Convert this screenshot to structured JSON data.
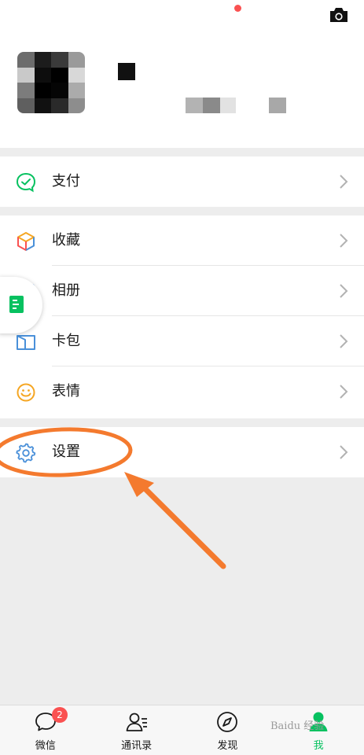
{
  "menu": {
    "pay": {
      "label": "支付",
      "icon": "pay-icon"
    },
    "favorites": {
      "label": "收藏",
      "icon": "favorites-cube-icon"
    },
    "album": {
      "label": "相册",
      "icon": "album-icon"
    },
    "cards": {
      "label": "卡包",
      "icon": "card-wallet-icon"
    },
    "stickers": {
      "label": "表情",
      "icon": "smiley-icon"
    },
    "settings": {
      "label": "设置",
      "icon": "gear-icon"
    }
  },
  "tabbar": {
    "chats": {
      "label": "微信",
      "badge": "2",
      "icon": "chat-bubble-icon"
    },
    "contacts": {
      "label": "通讯录",
      "icon": "contacts-icon"
    },
    "discover": {
      "label": "发现",
      "icon": "compass-icon"
    },
    "me": {
      "label": "我",
      "icon": "person-icon"
    }
  },
  "colors": {
    "accent": "#07c160",
    "badge": "#fa5151",
    "annotation": "#f47a2e",
    "settings_icon": "#4a90d9"
  },
  "watermark": "Baidu 经验"
}
